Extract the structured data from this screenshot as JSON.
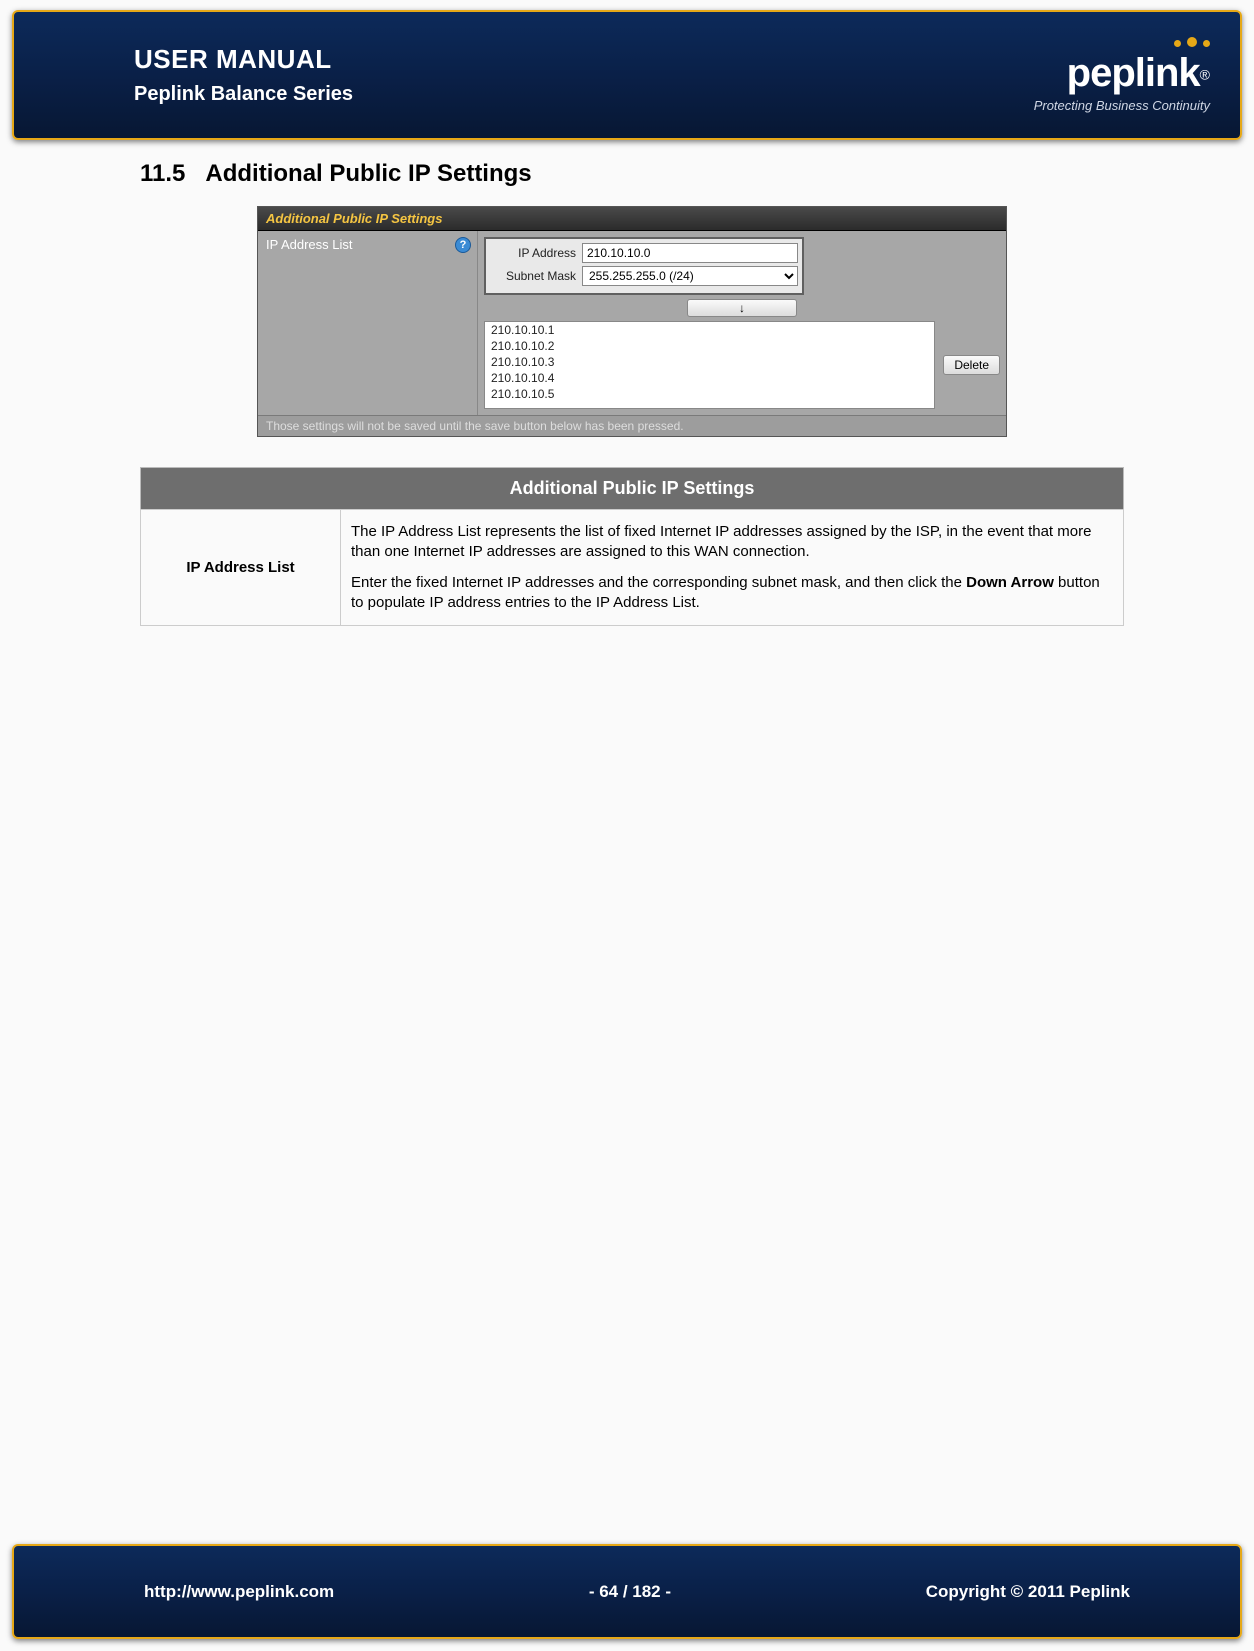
{
  "header": {
    "title": "USER MANUAL",
    "subtitle": "Peplink Balance Series",
    "logo_text": "peplink",
    "tagline": "Protecting Business Continuity"
  },
  "section": {
    "number": "11.5",
    "title": "Additional Public IP Settings"
  },
  "panel": {
    "header": "Additional Public IP Settings",
    "left_label": "IP Address List",
    "ip_label": "IP Address",
    "ip_value": "210.10.10.0",
    "mask_label": "Subnet Mask",
    "mask_value": "255.255.255.0 (/24)",
    "arrow_glyph": "↓",
    "list": [
      "210.10.10.1",
      "210.10.10.2",
      "210.10.10.3",
      "210.10.10.4",
      "210.10.10.5"
    ],
    "delete_label": "Delete",
    "note": "Those settings will not be saved until the save button below has been pressed."
  },
  "desc": {
    "table_header": "Additional Public IP Settings",
    "row_label": "IP Address List",
    "p1": "The IP Address List represents the list of fixed Internet IP addresses assigned by the ISP, in the event that more than one Internet IP addresses are assigned to this WAN connection.",
    "p2a": "Enter the fixed Internet IP addresses and the corresponding subnet mask, and then click the ",
    "p2bold": "Down Arrow",
    "p2b": " button to populate IP address entries to the IP Address List."
  },
  "footer": {
    "url": "http://www.peplink.com",
    "page": "- 64 / 182 -",
    "copyright": "Copyright © 2011 Peplink"
  }
}
